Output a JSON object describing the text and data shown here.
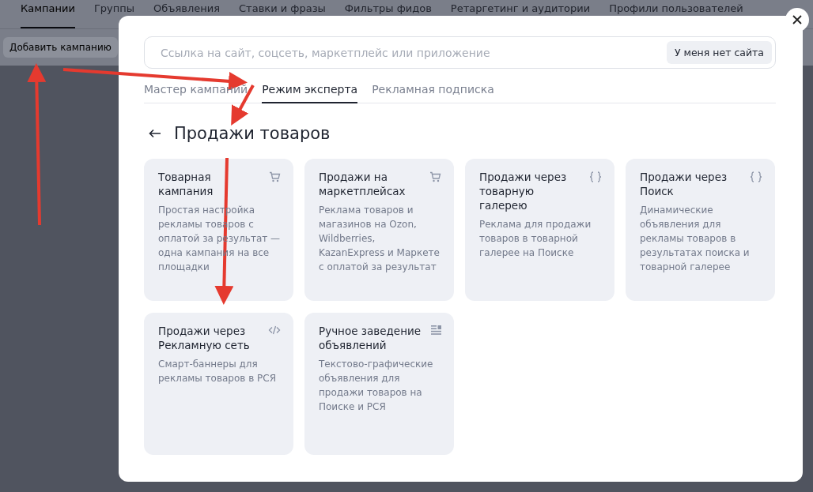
{
  "page_tabs": [
    {
      "label": "Кампании",
      "selected": true
    },
    {
      "label": "Группы",
      "selected": false
    },
    {
      "label": "Объявления",
      "selected": false
    },
    {
      "label": "Ставки и фразы",
      "selected": false
    },
    {
      "label": "Фильтры фидов",
      "selected": false
    },
    {
      "label": "Ретаргетинг и аудитории",
      "selected": false
    },
    {
      "label": "Профили пользователей",
      "selected": false
    }
  ],
  "add_button": "Добавить кампанию",
  "dialog": {
    "search": {
      "placeholder": "Ссылка на сайт, соцсеть, маркетплейс или приложение",
      "button": "У меня нет сайта"
    },
    "tabs": [
      {
        "label": "Мастер кампаний",
        "selected": false
      },
      {
        "label": "Режим эксперта",
        "selected": true
      },
      {
        "label": "Рекламная подписка",
        "selected": false
      }
    ],
    "heading": "Продажи товаров",
    "cards": [
      {
        "kind": "cart",
        "title": "Товарная кампания",
        "description": "Простая настройка рекламы товаров с оплатой за результат — одна кампания на все площадки"
      },
      {
        "kind": "cart",
        "title": "Продажи на маркетплейсах",
        "description": "Реклама товаров и магазинов на Ozon, Wildberries, KazanExpress и Маркете с оплатой за результат"
      },
      {
        "kind": "braces",
        "title": "Продажи через товарную галерею",
        "description": "Реклама для продажи товаров в товарной галерее на Поиске"
      },
      {
        "kind": "braces",
        "title": "Продажи через Поиск",
        "description": "Динамические объявления для рекламы товаров в результатах поиска и товарной галерее"
      },
      {
        "kind": "code",
        "title": "Продажи через Рекламную сеть",
        "description": "Смарт-баннеры для рекламы товаров в РСЯ"
      },
      {
        "kind": "list",
        "title": "Ручное заведение объявлений",
        "description": "Текстово-графические объявления для продажи товаров на Поиске и РСЯ"
      }
    ]
  }
}
